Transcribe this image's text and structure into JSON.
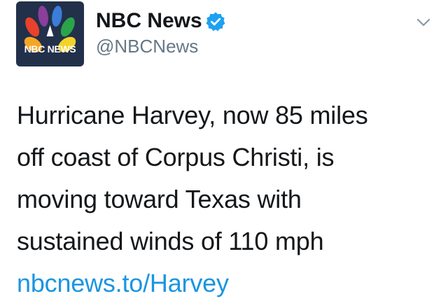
{
  "account": {
    "display_name": "NBC News",
    "handle": "@NBCNews",
    "verified": true,
    "avatar_text": "NBC NEWS",
    "avatar_icon": "nbc-peacock-logo",
    "verified_icon": "verified-badge-icon"
  },
  "menu": {
    "icon": "chevron-down-icon"
  },
  "tweet": {
    "lines": [
      "Hurricane Harvey, now 85 miles",
      "off coast of Corpus Christi, is",
      "moving toward Texas with",
      "sustained winds of 110 mph"
    ],
    "link": "nbcnews.to/Harvey"
  },
  "colors": {
    "link": "#1b95e0",
    "verified": "#1da1f2",
    "handle": "#657786",
    "avatar_bg": "#22304a"
  }
}
